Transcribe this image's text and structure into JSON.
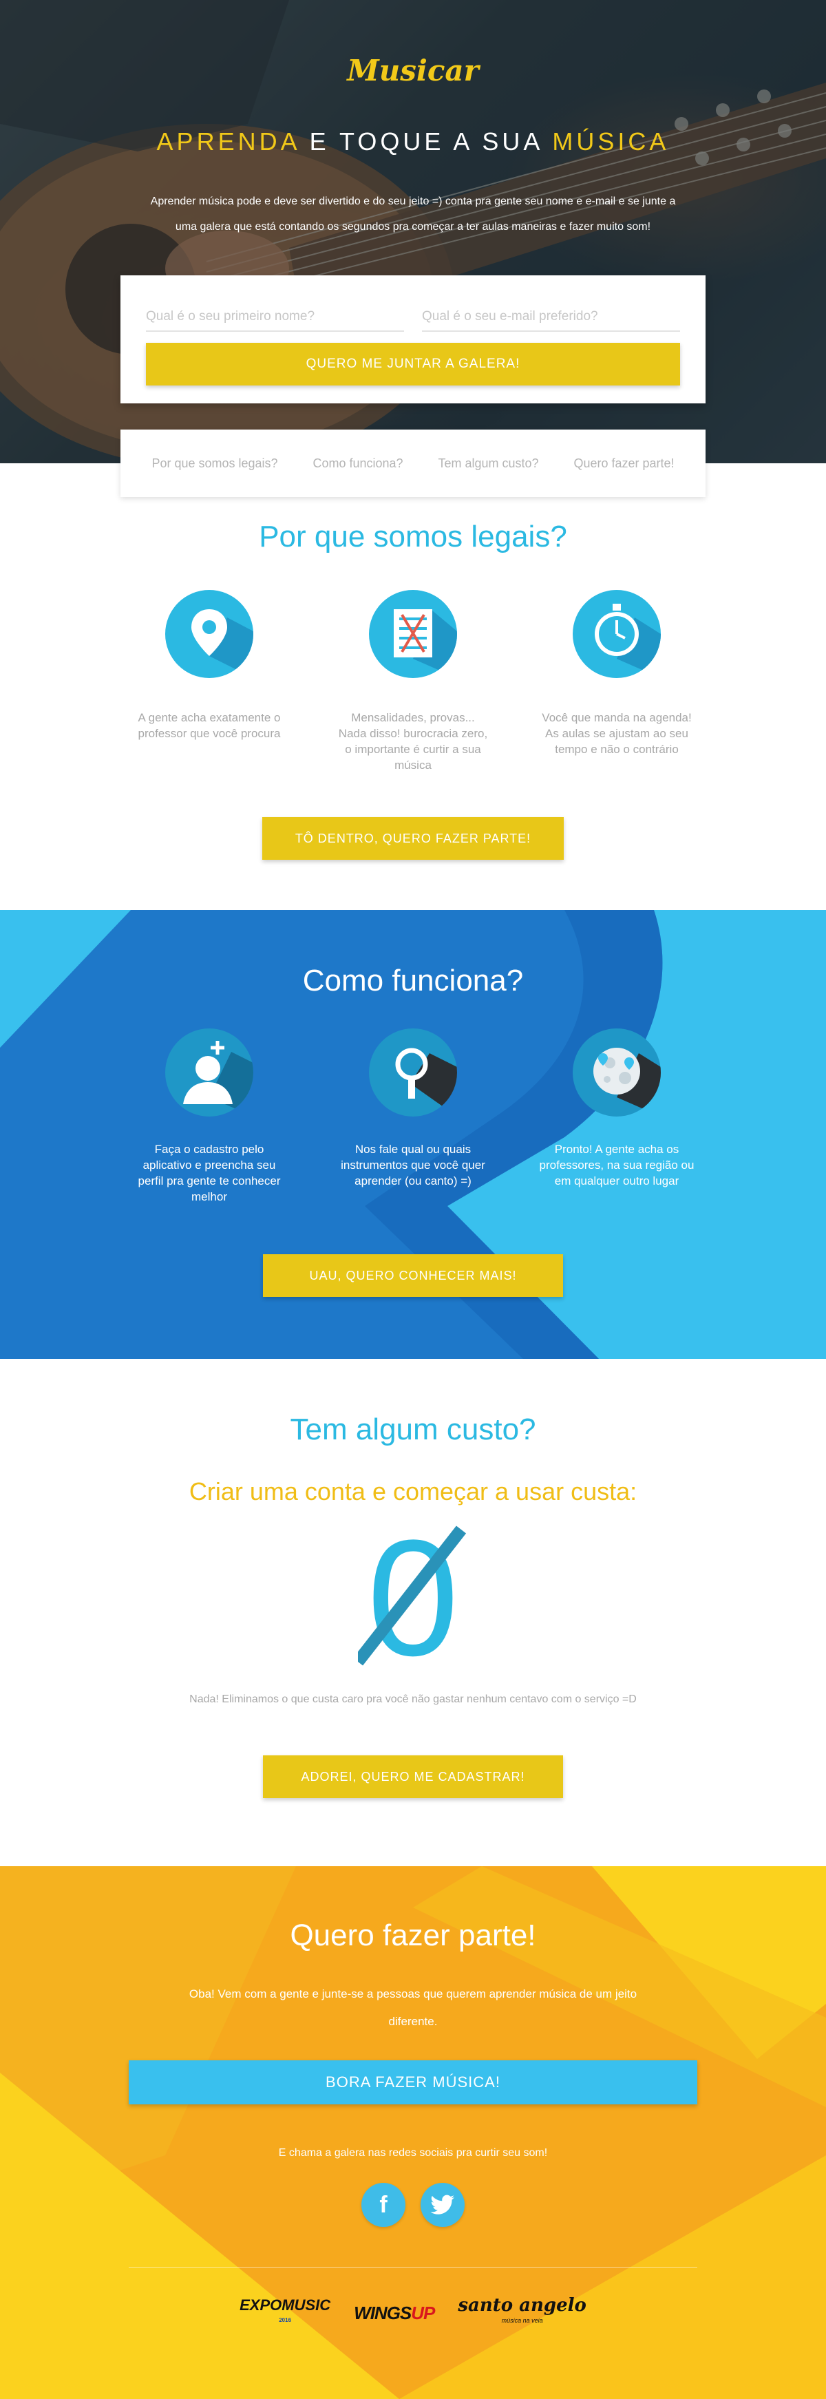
{
  "brand": {
    "logo": "Musicar"
  },
  "hero": {
    "title_hl1": "APRENDA",
    "title_mid": " E TOQUE A SUA ",
    "title_hl2": "MÚSICA",
    "subtitle": "Aprender música pode e deve ser divertido e do seu jeito =) conta pra gente seu nome e e-mail e se junte a uma galera que está contando os segundos pra começar a ter aulas maneiras e fazer muito som!",
    "name_placeholder": "Qual é o seu primeiro nome?",
    "email_placeholder": "Qual é o seu e-mail preferido?",
    "join_button": "QUERO ME JUNTAR A GALERA!"
  },
  "nav": {
    "items": [
      {
        "label": "Por que somos legais?"
      },
      {
        "label": "Como funciona?"
      },
      {
        "label": "Tem algum custo?"
      },
      {
        "label": "Quero fazer parte!"
      }
    ]
  },
  "legais": {
    "title": "Por que somos legais?",
    "features": [
      {
        "icon": "map-pin-icon",
        "text": "A gente acha exatamente o professor que você procura"
      },
      {
        "icon": "checklist-icon",
        "text": "Mensalidades, provas... Nada disso! burocracia zero, o importante é curtir a sua música"
      },
      {
        "icon": "stopwatch-icon",
        "text": "Você que manda na agenda! As aulas se ajustam ao seu tempo e não o contrário"
      }
    ],
    "button": "TÔ DENTRO, QUERO FAZER PARTE!"
  },
  "como": {
    "title": "Como funciona?",
    "features": [
      {
        "icon": "add-user-icon",
        "text": "Faça o cadastro pelo aplicativo e preencha seu perfil pra gente te conhecer melhor"
      },
      {
        "icon": "magnifier-icon",
        "text": "Nos fale qual ou quais instrumentos que você quer aprender (ou canto) =)"
      },
      {
        "icon": "map-icon",
        "text": "Pronto! A gente acha os professores, na sua região ou em qualquer outro lugar"
      }
    ],
    "button": "UAU, QUERO CONHECER MAIS!"
  },
  "custo": {
    "title": "Tem algum custo?",
    "subtitle": "Criar uma conta e começar a usar custa:",
    "zero": "0",
    "note": "Nada! Eliminamos o que custa caro pra você não gastar nenhum centavo com o serviço =D",
    "button": "ADOREI, QUERO ME CADASTRAR!"
  },
  "parte": {
    "title": "Quero fazer parte!",
    "text": "Oba! Vem com a gente e junte-se a pessoas que querem aprender música de um jeito diferente.",
    "button": "BORA FAZER MÚSICA!",
    "share_text": "E chama a galera nas redes sociais pra curtir seu som!",
    "socials": [
      {
        "icon": "facebook-icon",
        "glyph": "f"
      },
      {
        "icon": "twitter-icon"
      }
    ],
    "sponsors": {
      "expo": "EXPOMUSIC",
      "expo_year": "2016",
      "wings": "WINGS",
      "wings_up": "UP",
      "santo": "santo angelo",
      "santo_tag": "música na veia"
    }
  },
  "colors": {
    "blue": "#2bb9e2",
    "yellow": "#e8c718",
    "orange": "#f6a91d",
    "dark_blue": "#1565b8"
  }
}
